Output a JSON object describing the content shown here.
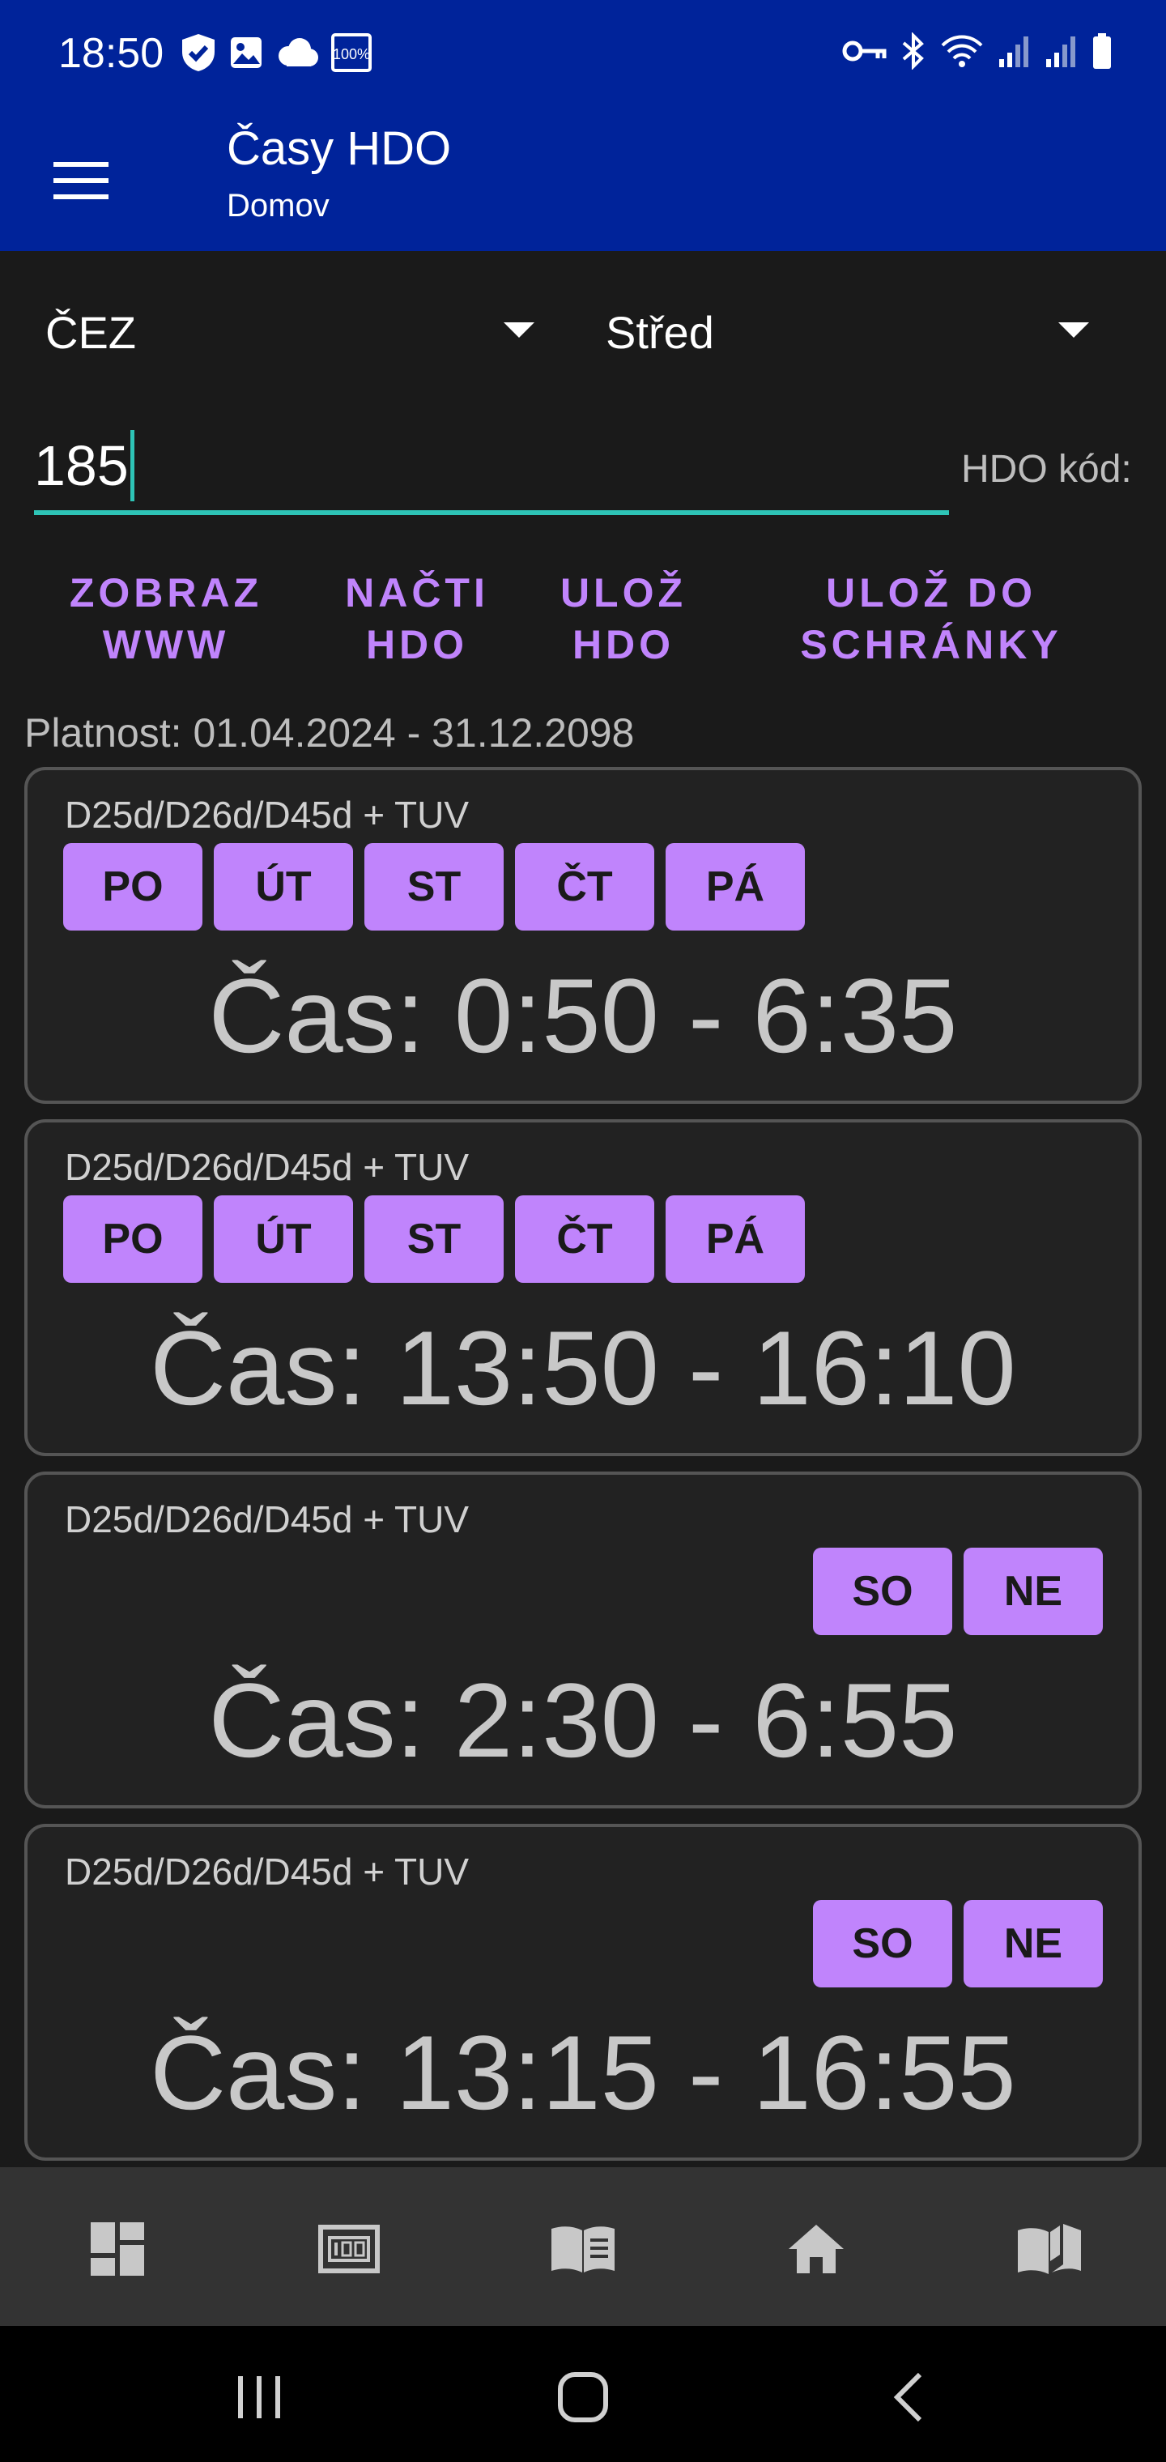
{
  "status_bar": {
    "time": "18:50",
    "left_icons": [
      "shield-check-icon",
      "image-icon",
      "cloud-icon",
      "battery-saver-100-icon"
    ],
    "right_icons": [
      "key-icon",
      "bluetooth-icon",
      "wifi-icon",
      "signal-icon",
      "signal-icon",
      "battery-icon"
    ],
    "battery_badge": "100%"
  },
  "app_bar": {
    "title": "Časy HDO",
    "subtitle": "Domov"
  },
  "filters": {
    "provider": "ČEZ",
    "region": "Střed"
  },
  "hdo_code": {
    "value": "185",
    "label": "HDO kód:"
  },
  "actions": {
    "show_www": "ZOBRAZ\nWWW",
    "load_hdo": "NAČTI\nHDO",
    "save_hdo": "ULOŽ\nHDO",
    "save_clipboard": "ULOŽ DO\nSCHRÁNKY"
  },
  "validity": "Platnost: 01.04.2024 - 31.12.2098",
  "cards": [
    {
      "tariff": "D25d/D26d/D45d + TUV",
      "days": [
        "PO",
        "ÚT",
        "ST",
        "ČT",
        "PÁ"
      ],
      "time": "Čas: 0:50 - 6:35"
    },
    {
      "tariff": "D25d/D26d/D45d + TUV",
      "days": [
        "PO",
        "ÚT",
        "ST",
        "ČT",
        "PÁ"
      ],
      "time": "Čas: 13:50 - 16:10"
    },
    {
      "tariff": "D25d/D26d/D45d + TUV",
      "days": [
        "SO",
        "NE"
      ],
      "time": "Čas: 2:30 - 6:55"
    },
    {
      "tariff": "D25d/D26d/D45d + TUV",
      "days": [
        "SO",
        "NE"
      ],
      "time": "Čas: 13:15 - 16:55"
    }
  ],
  "bottom_nav": [
    "dashboard-icon",
    "meter-icon",
    "book-list-icon",
    "home-icon",
    "map-book-icon"
  ],
  "colors": {
    "app_bar": "#00239a",
    "accent": "#c084fc",
    "input_underline": "#2ec4b6",
    "background": "#1a1a1a",
    "card": "#222222"
  }
}
